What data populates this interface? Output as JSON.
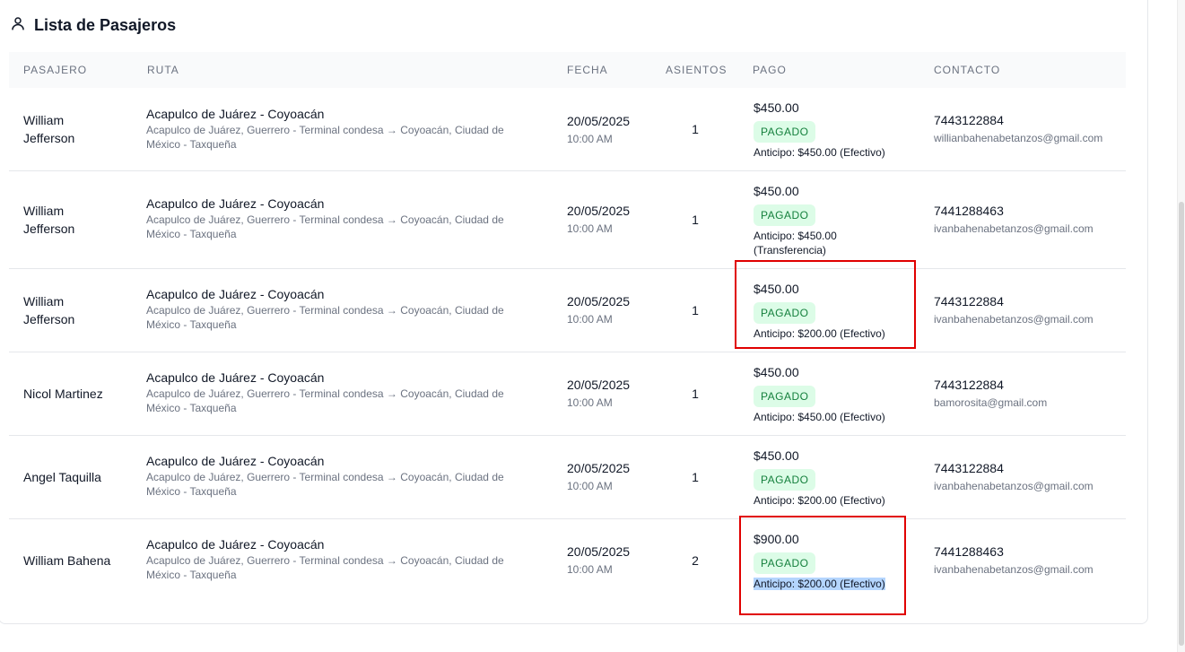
{
  "header": {
    "title": "Lista de Pasajeros",
    "icon": "user-icon"
  },
  "columns": {
    "passenger": "PASAJERO",
    "route": "RUTA",
    "date": "FECHA",
    "seats": "ASIENTOS",
    "payment": "PAGO",
    "contact": "CONTACTO"
  },
  "rows": [
    {
      "name": "William Jefferson",
      "route_title": "Acapulco de Juárez - Coyoacán",
      "route_desc": "Acapulco de Juárez, Guerrero - Terminal condesa → Coyoacán, Ciudad de México - Taxqueña",
      "date": "20/05/2025",
      "time": "10:00 AM",
      "seats": "1",
      "amount": "$450.00",
      "status": "PAGADO",
      "advance": "Anticipo: $450.00 (Efectivo)",
      "phone": "7443122884",
      "email": "willianbahenabetanzos@gmail.com"
    },
    {
      "name": "William Jefferson",
      "route_title": "Acapulco de Juárez - Coyoacán",
      "route_desc": "Acapulco de Juárez, Guerrero - Terminal condesa → Coyoacán, Ciudad de México - Taxqueña",
      "date": "20/05/2025",
      "time": "10:00 AM",
      "seats": "1",
      "amount": "$450.00",
      "status": "PAGADO",
      "advance": "Anticipo: $450.00 (Transferencia)",
      "phone": "7441288463",
      "email": "ivanbahenabetanzos@gmail.com"
    },
    {
      "name": "William Jefferson",
      "route_title": "Acapulco de Juárez - Coyoacán",
      "route_desc": "Acapulco de Juárez, Guerrero - Terminal condesa → Coyoacán, Ciudad de México - Taxqueña",
      "date": "20/05/2025",
      "time": "10:00 AM",
      "seats": "1",
      "amount": "$450.00",
      "status": "PAGADO",
      "advance": "Anticipo: $200.00 (Efectivo)",
      "phone": "7443122884",
      "email": "ivanbahenabetanzos@gmail.com"
    },
    {
      "name": "Nicol Martinez",
      "route_title": "Acapulco de Juárez - Coyoacán",
      "route_desc": "Acapulco de Juárez, Guerrero - Terminal condesa → Coyoacán, Ciudad de México - Taxqueña",
      "date": "20/05/2025",
      "time": "10:00 AM",
      "seats": "1",
      "amount": "$450.00",
      "status": "PAGADO",
      "advance": "Anticipo: $450.00 (Efectivo)",
      "phone": "7443122884",
      "email": "bamorosita@gmail.com"
    },
    {
      "name": "Angel Taquilla",
      "route_title": "Acapulco de Juárez - Coyoacán",
      "route_desc": "Acapulco de Juárez, Guerrero - Terminal condesa → Coyoacán, Ciudad de México - Taxqueña",
      "date": "20/05/2025",
      "time": "10:00 AM",
      "seats": "1",
      "amount": "$450.00",
      "status": "PAGADO",
      "advance": "Anticipo: $200.00 (Efectivo)",
      "phone": "7443122884",
      "email": "ivanbahenabetanzos@gmail.com"
    },
    {
      "name": "William Bahena",
      "route_title": "Acapulco de Juárez - Coyoacán",
      "route_desc": "Acapulco de Juárez, Guerrero - Terminal condesa → Coyoacán, Ciudad de México - Taxqueña",
      "date": "20/05/2025",
      "time": "10:00 AM",
      "seats": "2",
      "amount": "$900.00",
      "status": "PAGADO",
      "advance": "Anticipo: $200.00 (Efectivo)",
      "phone": "7441288463",
      "email": "ivanbahenabetanzos@gmail.com"
    }
  ],
  "colors": {
    "badge_bg": "#dcfce7",
    "badge_text": "#15803d",
    "annotation": "#e00000",
    "selection": "#b4d5fe"
  }
}
